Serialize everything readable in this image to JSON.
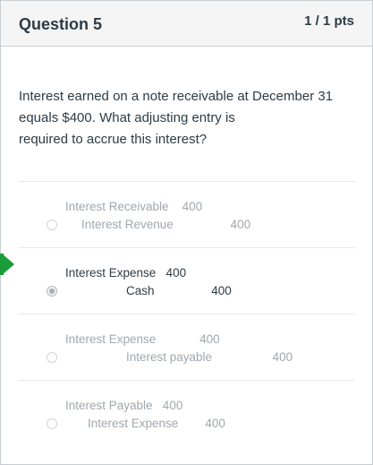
{
  "question": {
    "title": "Question 5",
    "points": "1 / 1 pts",
    "text_lines": [
      "Interest earned on a note receivable at December 31",
      "equals $400. What adjusting entry is",
      "required to accrue this interest?"
    ]
  },
  "answers": [
    {
      "line1": "Interest Receivable    400",
      "line2": "Interest Revenue                 400",
      "selected": false,
      "correct": false
    },
    {
      "line1": "Interest Expense   400",
      "line2": "Cash                 400",
      "selected": true,
      "correct": true
    },
    {
      "line1": "Interest Expense             400",
      "line2": "Interest payable                  400",
      "selected": false,
      "correct": false
    },
    {
      "line1": "Interest Payable   400",
      "line2": "Interest Expense        400",
      "selected": false,
      "correct": false
    }
  ],
  "colors": {
    "correct_marker": "#1a9c3a",
    "header_bg": "#f5f5f5",
    "text": "#2d3b45",
    "muted_text": "#a0a7ad"
  }
}
